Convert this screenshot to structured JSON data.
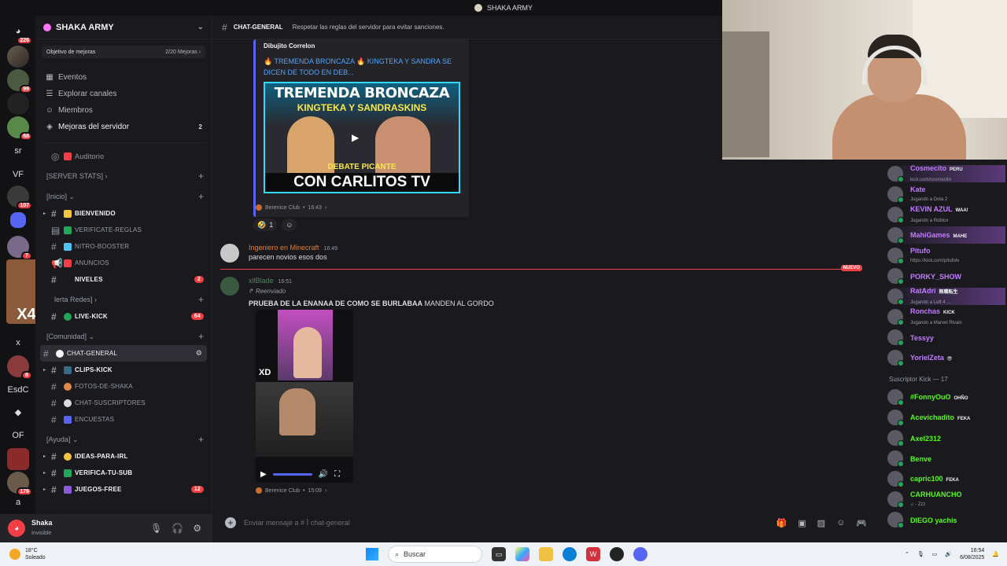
{
  "window": {
    "title": "SHAKA ARMY"
  },
  "rail": {
    "items": [
      {
        "label": "",
        "badge": "226"
      },
      {
        "label": "",
        "badge": ""
      },
      {
        "label": "",
        "badge": "99"
      },
      {
        "label": "",
        "badge": ""
      },
      {
        "label": "",
        "badge": "68"
      },
      {
        "label": "sr",
        "badge": ""
      },
      {
        "label": "VF",
        "badge": ""
      },
      {
        "label": "",
        "badge": "107"
      },
      {
        "label": "",
        "badge": ""
      },
      {
        "label": "",
        "badge": "7"
      },
      {
        "label": "X49",
        "badge": "80"
      },
      {
        "label": "x",
        "badge": ""
      },
      {
        "label": "",
        "badge": "8"
      },
      {
        "label": "EsdC",
        "badge": ""
      },
      {
        "label": "",
        "badge": ""
      },
      {
        "label": "OF",
        "badge": ""
      },
      {
        "label": "",
        "badge": ""
      },
      {
        "label": "",
        "badge": "176"
      },
      {
        "label": "a",
        "badge": ""
      }
    ]
  },
  "sidebar": {
    "server_name": "SHAKA ARMY",
    "goal": {
      "label": "Objetivo de mejoras",
      "progress": "2/20 Mejoras"
    },
    "nav": [
      {
        "label": "Eventos",
        "count": ""
      },
      {
        "label": "Explorar canales",
        "count": ""
      },
      {
        "label": "Miembros",
        "count": ""
      },
      {
        "label": "Mejoras del servidor",
        "count": "2"
      }
    ],
    "auditorio": "Auditorio",
    "categories": {
      "server_stats": "[SERVER STATS]",
      "inicio": "[Inicio]",
      "alerta_redes": "lerta Redes]",
      "comunidad": "[Comunidad]",
      "ayuda": "[Ayuda]"
    },
    "channels_inicio": [
      {
        "name": "bienvenido",
        "mention": ""
      },
      {
        "name": "verificate-reglas",
        "mention": ""
      },
      {
        "name": "nitro-booster",
        "mention": ""
      },
      {
        "name": "anuncios",
        "mention": ""
      },
      {
        "name": "niveles",
        "mention": "2"
      }
    ],
    "channels_alerta": [
      {
        "name": "live-kick",
        "mention": "64"
      }
    ],
    "channels_comunidad": [
      {
        "name": "chat-general",
        "mention": ""
      },
      {
        "name": "clips-kick",
        "mention": ""
      },
      {
        "name": "fotos-de-shaka",
        "mention": ""
      },
      {
        "name": "chat-suscriptores",
        "mention": ""
      },
      {
        "name": "encuestas",
        "mention": ""
      }
    ],
    "channels_ayuda": [
      {
        "name": "ideas-para-irl",
        "mention": ""
      },
      {
        "name": "verifica-tu-sub",
        "mention": ""
      },
      {
        "name": "juegos-free",
        "mention": "12"
      }
    ]
  },
  "user": {
    "name": "Shaka",
    "status": "Invisible"
  },
  "header": {
    "channel": "chat-general",
    "topic": "Respetar las reglas del servidor para evitar sanciones."
  },
  "messages": {
    "embed": {
      "author": "Dibujito Correlon",
      "title": "🔥 TREMENDA BRONCAZA 🔥 KINGTEKA Y SANDRA SE DICEN DE TODO EN DEB...",
      "thumb_line1": "TREMENDA BRONCAZA",
      "thumb_line2": "KINGTEKA Y SANDRASKINS",
      "thumb_line3": "DEBATE PICANTE",
      "thumb_line4": "CON CARLITOS TV",
      "source": "Berenice Club",
      "source_time": "16:43",
      "reaction_count": "1"
    },
    "msg1": {
      "author": "Ingeniero en Minecraft",
      "time": "16:49",
      "text": "parecen novios esos dos"
    },
    "new_label": "NUEVO",
    "msg2": {
      "author": "xllBlade",
      "time": "16:51",
      "forwarded": "Reenviado",
      "text_bold": "PRUEBA DE LA ENANAA DE COMO SE BURLABAA",
      "text_rest": " MANDEN AL GORDO",
      "video_overlay": "XD",
      "source": "Berenice Club",
      "source_time": "15:09"
    }
  },
  "composer": {
    "placeholder": "Enviar mensaje a #  ꟾ chat-general"
  },
  "members": {
    "online": [
      {
        "name": "Cosmecito",
        "tag": "PERU",
        "status": "kick.com/cosmecito",
        "color": "#c27cff",
        "hl": true
      },
      {
        "name": "Kate",
        "tag": "",
        "status": "Jugando a Dota 2",
        "color": "#c27cff",
        "hl": false
      },
      {
        "name": "KEVIN AZUL",
        "tag": "WAA!",
        "status": "Jugando a Roblox",
        "color": "#c27cff",
        "hl": false
      },
      {
        "name": "MahiGames",
        "tag": "MAHE",
        "status": "",
        "color": "#c27cff",
        "hl": true
      },
      {
        "name": "Pitufo",
        "tag": "",
        "status": "https://kick.com/pitufotv",
        "color": "#c27cff",
        "hl": false
      },
      {
        "name": "PORKY_SHOW",
        "tag": "",
        "status": "",
        "color": "#c27cff",
        "hl": false
      },
      {
        "name": "RatAdri",
        "tag": "無職転生",
        "status": "Jugando a Left 4 ...",
        "color": "#c27cff",
        "hl": true
      },
      {
        "name": "Ronchas",
        "tag": "KICK",
        "status": "Jugando a Marvel Rivals",
        "color": "#c27cff",
        "hl": false
      },
      {
        "name": "Tessyy",
        "tag": "",
        "status": "",
        "color": "#c27cff",
        "hl": false
      },
      {
        "name": "YorielZeta",
        "tag": "😎",
        "status": "",
        "color": "#c27cff",
        "hl": false
      }
    ],
    "section": "Suscriptor Kick — 17",
    "subs": [
      {
        "name": "#FonnyOuO",
        "tag": "OHÑO",
        "status": "",
        "color": "#53fc18"
      },
      {
        "name": "Acevichadito",
        "tag": "FEKA",
        "status": "",
        "color": "#53fc18"
      },
      {
        "name": "Axel2312",
        "tag": "",
        "status": "",
        "color": "#53fc18"
      },
      {
        "name": "Benve",
        "tag": "",
        "status": "",
        "color": "#53fc18"
      },
      {
        "name": "capric100",
        "tag": "FEKA",
        "status": "",
        "color": "#53fc18"
      },
      {
        "name": "CARHUANCHO",
        "tag": "",
        "status": "♫ - Zzz",
        "color": "#53fc18"
      },
      {
        "name": "DIEGO yachis",
        "tag": "",
        "status": "",
        "color": "#53fc18"
      }
    ]
  },
  "taskbar": {
    "weather_temp": "18°C",
    "weather_desc": "Soleado",
    "search_label": "Buscar",
    "time": "16:54",
    "date": "6/08/2025"
  },
  "colors": {
    "accent": "#5865f2",
    "danger": "#f23f43",
    "kick": "#53fc18",
    "sub": "#c27cff"
  }
}
